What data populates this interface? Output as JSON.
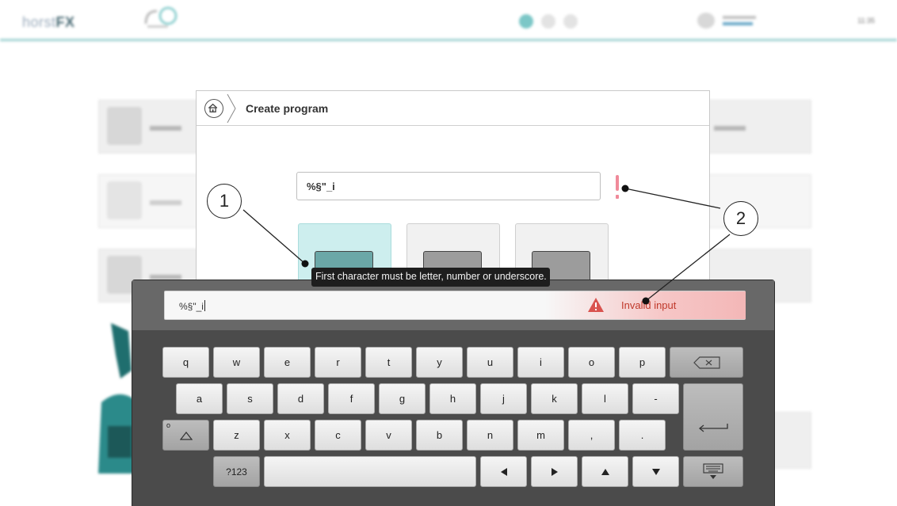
{
  "topbar": {
    "logo_thin": "horst",
    "logo_bold": "FX",
    "clock": "11:35"
  },
  "dialog": {
    "title": "Create program",
    "name_value": "%§\"_i",
    "error_mark": "!"
  },
  "tooltip": {
    "text": "First character must be letter, number or underscore."
  },
  "keyboard": {
    "input_value": "%§\"_i",
    "invalid_label": "Invalid input",
    "row1": [
      "q",
      "w",
      "e",
      "r",
      "t",
      "y",
      "u",
      "i",
      "o",
      "p"
    ],
    "row2": [
      "a",
      "s",
      "d",
      "f",
      "g",
      "h",
      "j",
      "k",
      "l",
      "-"
    ],
    "row3": [
      "z",
      "x",
      "c",
      "v",
      "b",
      "n",
      "m",
      ",",
      "."
    ],
    "numeric_label": "?123",
    "shift_marker": "o"
  },
  "callouts": {
    "one": "1",
    "two": "2"
  },
  "colors": {
    "accent_teal": "#9fd2d2",
    "error_red": "#c0392b",
    "error_bg": "#f6c6c6",
    "keyboard_bg": "#4b4b4b"
  }
}
